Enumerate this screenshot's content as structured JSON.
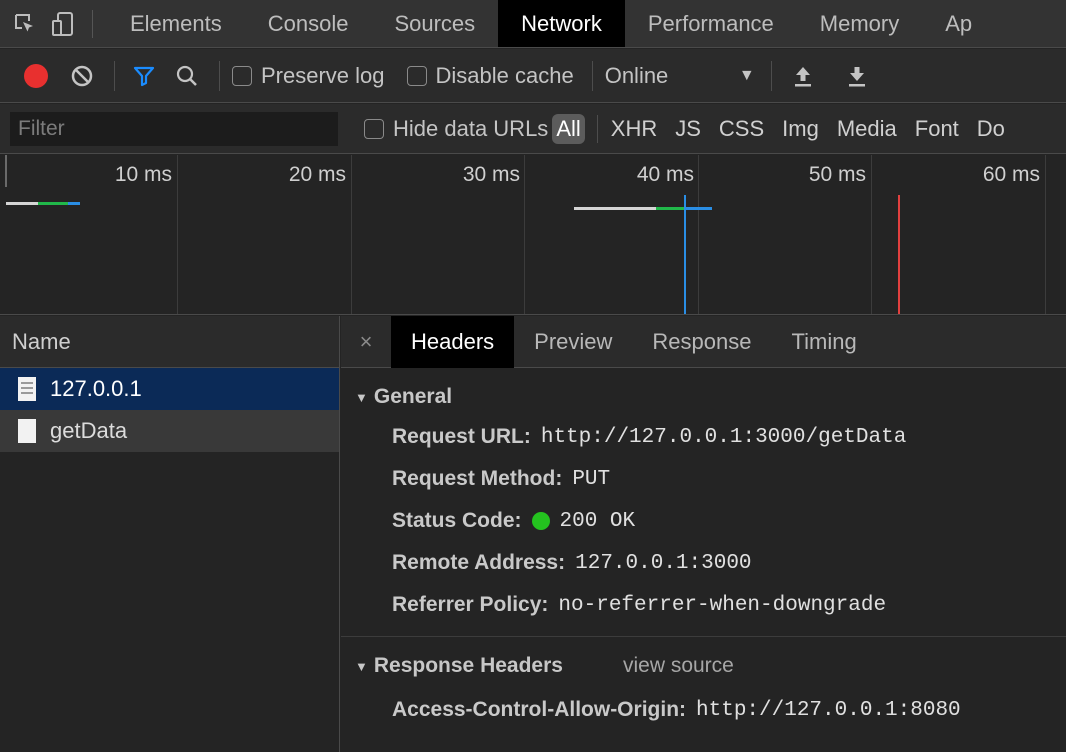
{
  "main_tabs": [
    "Elements",
    "Console",
    "Sources",
    "Network",
    "Performance",
    "Memory",
    "Ap"
  ],
  "active_tab": "Network",
  "toolbar": {
    "preserve_log": "Preserve log",
    "disable_cache": "Disable cache",
    "throttle": "Online"
  },
  "filter": {
    "placeholder": "Filter",
    "hide_data_urls": "Hide data URLs",
    "types": [
      "All",
      "XHR",
      "JS",
      "CSS",
      "Img",
      "Media",
      "Font",
      "Do"
    ]
  },
  "timeline": {
    "ticks": [
      "10 ms",
      "20 ms",
      "30 ms",
      "40 ms",
      "50 ms",
      "60 ms"
    ]
  },
  "requests": {
    "header": "Name",
    "items": [
      "127.0.0.1",
      "getData"
    ]
  },
  "detail": {
    "tabs": [
      "Headers",
      "Preview",
      "Response",
      "Timing"
    ],
    "close": "×",
    "general": {
      "title": "General",
      "request_url_label": "Request URL:",
      "request_url": "http://127.0.0.1:3000/getData",
      "method_label": "Request Method:",
      "method": "PUT",
      "status_label": "Status Code:",
      "status": "200 OK",
      "remote_label": "Remote Address:",
      "remote": "127.0.0.1:3000",
      "referrer_label": "Referrer Policy:",
      "referrer": "no-referrer-when-downgrade"
    },
    "response_headers": {
      "title": "Response Headers",
      "view_source": "view source",
      "acao_label": "Access-Control-Allow-Origin:",
      "acao": "http://127.0.0.1:8080"
    }
  },
  "colors": {
    "record": "#e8302f",
    "filter_active": "#1a8cff",
    "status_ok": "#24c21f",
    "selected_row": "#0b2a57"
  }
}
